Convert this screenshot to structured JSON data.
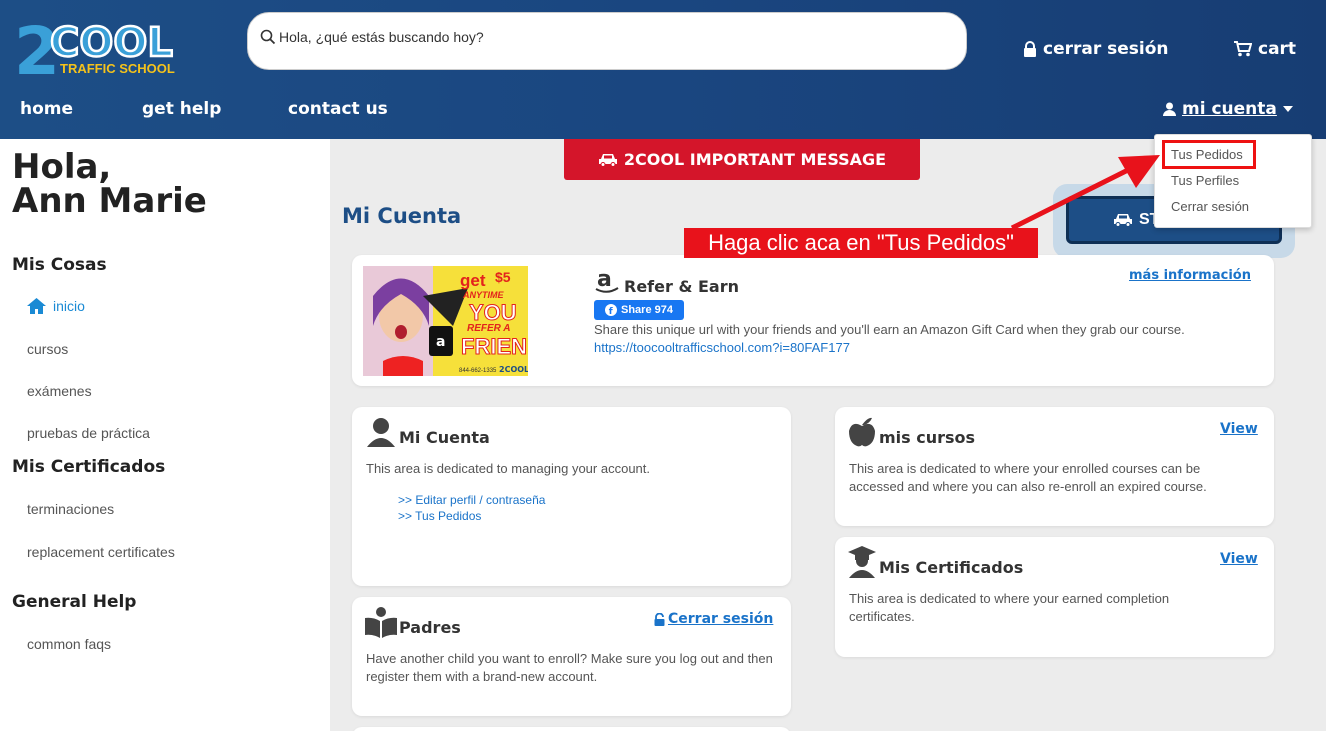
{
  "header": {
    "logo_text": "2COOL",
    "logo_subtext": "TRAFFIC SCHOOL",
    "search_placeholder": "Hola, ¿qué estás buscando hoy?",
    "logout": "cerrar sesión",
    "cart": "cart",
    "nav": [
      "home",
      "get help",
      "contact us"
    ],
    "account": "mi cuenta"
  },
  "dropdown": {
    "items": [
      "Tus Pedidos",
      "Tus Perfiles",
      "Cerrar sesión"
    ]
  },
  "callout": "Haga clic aca en \"Tus Pedidos\"",
  "sidebar": {
    "greeting_line1": "Hola,",
    "greeting_line2": "Ann Marie",
    "section1": "Mis Cosas",
    "items1": [
      "inicio",
      "cursos",
      "exámenes",
      "pruebas de práctica"
    ],
    "section2": "Mis Certificados",
    "items2": [
      "terminaciones",
      "replacement certificates"
    ],
    "section3": "General Help",
    "items3": [
      "common faqs"
    ]
  },
  "main": {
    "important_message": "2COOL IMPORTANT MESSAGE",
    "page_title": "Mi Cuenta",
    "start_button": "ST"
  },
  "refer": {
    "title": "Refer & Earn",
    "more_info": "más información",
    "share_label": "Share 974",
    "text": "Share this unique url with your friends and you'll earn an Amazon Gift Card when they grab our course.",
    "url": "https://toocooltrafficschool.com?i=80FAF177",
    "promo_get": "get",
    "promo_amount": "$5",
    "promo_anytime": "ANYTIME",
    "promo_you": "YOU",
    "promo_refer": "REFER A",
    "promo_friend": "FRIEND",
    "promo_phone": "844-662-1335"
  },
  "cards": {
    "mi_cuenta": {
      "title": "Mi Cuenta",
      "text": "This area is dedicated to managing your account.",
      "link1": ">> Editar perfil / contraseña",
      "link2": ">> Tus Pedidos"
    },
    "mis_cursos": {
      "title": "mis cursos",
      "view": "View",
      "text": "This area is dedicated to where your enrolled courses can be accessed and where you can also re-enroll an expired course."
    },
    "padres": {
      "title": "Padres",
      "logout": "Cerrar sesión",
      "text": "Have another child you want to enroll? Make sure you log out and then register them with a brand-new account."
    },
    "mis_certificados": {
      "title": "Mis Certificados",
      "view": "View",
      "text": "This area is dedicated to where your earned completion certificates."
    }
  },
  "colors": {
    "header_blue": "#1d4e86",
    "important_red": "#d4152a",
    "callout_red": "#e8121b",
    "link_blue": "#1a73c9"
  }
}
